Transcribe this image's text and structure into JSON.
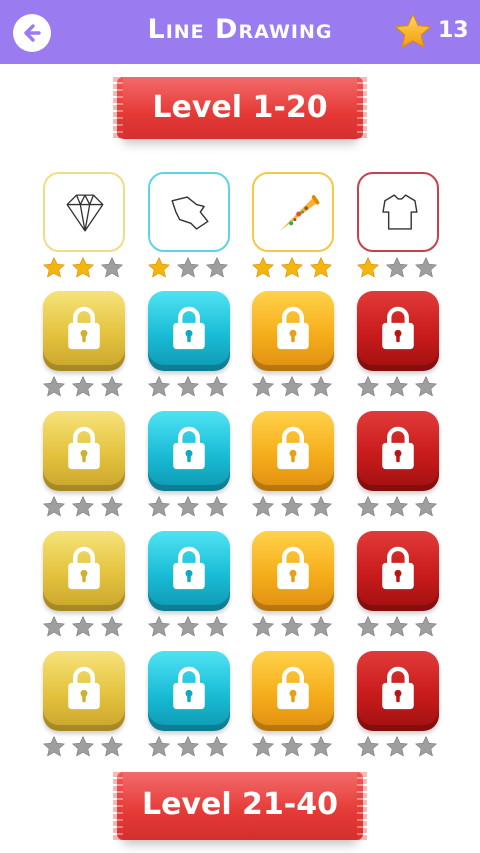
{
  "header": {
    "title": "Line Drawing",
    "star_total": "13",
    "back_icon": "back-arrow-icon",
    "star_icon": "star-icon",
    "color": "#9b7cf0"
  },
  "banners": {
    "top": "Level 1-20",
    "bottom": "Level 21-40",
    "color": "#e53935"
  },
  "levels": [
    {
      "state": "unlocked",
      "icon": "diamond-drawing",
      "stars": 2,
      "color": "yellow"
    },
    {
      "state": "unlocked",
      "icon": "fish-drawing",
      "stars": 1,
      "color": "cyan"
    },
    {
      "state": "unlocked",
      "icon": "pizza-slice",
      "stars": 3,
      "color": "orange"
    },
    {
      "state": "unlocked",
      "icon": "tshirt-drawing",
      "stars": 1,
      "color": "red"
    },
    {
      "state": "locked",
      "icon": "lock-icon",
      "stars": 0,
      "color": "yellow"
    },
    {
      "state": "locked",
      "icon": "lock-icon",
      "stars": 0,
      "color": "cyan"
    },
    {
      "state": "locked",
      "icon": "lock-icon",
      "stars": 0,
      "color": "orange"
    },
    {
      "state": "locked",
      "icon": "lock-icon",
      "stars": 0,
      "color": "red"
    },
    {
      "state": "locked",
      "icon": "lock-icon",
      "stars": 0,
      "color": "yellow"
    },
    {
      "state": "locked",
      "icon": "lock-icon",
      "stars": 0,
      "color": "cyan"
    },
    {
      "state": "locked",
      "icon": "lock-icon",
      "stars": 0,
      "color": "orange"
    },
    {
      "state": "locked",
      "icon": "lock-icon",
      "stars": 0,
      "color": "red"
    },
    {
      "state": "locked",
      "icon": "lock-icon",
      "stars": 0,
      "color": "yellow"
    },
    {
      "state": "locked",
      "icon": "lock-icon",
      "stars": 0,
      "color": "cyan"
    },
    {
      "state": "locked",
      "icon": "lock-icon",
      "stars": 0,
      "color": "orange"
    },
    {
      "state": "locked",
      "icon": "lock-icon",
      "stars": 0,
      "color": "red"
    },
    {
      "state": "locked",
      "icon": "lock-icon",
      "stars": 0,
      "color": "yellow"
    },
    {
      "state": "locked",
      "icon": "lock-icon",
      "stars": 0,
      "color": "cyan"
    },
    {
      "state": "locked",
      "icon": "lock-icon",
      "stars": 0,
      "color": "orange"
    },
    {
      "state": "locked",
      "icon": "lock-icon",
      "stars": 0,
      "color": "red"
    }
  ],
  "star_colors": {
    "earned": "#f5b50f",
    "empty": "#9e9e9e"
  }
}
